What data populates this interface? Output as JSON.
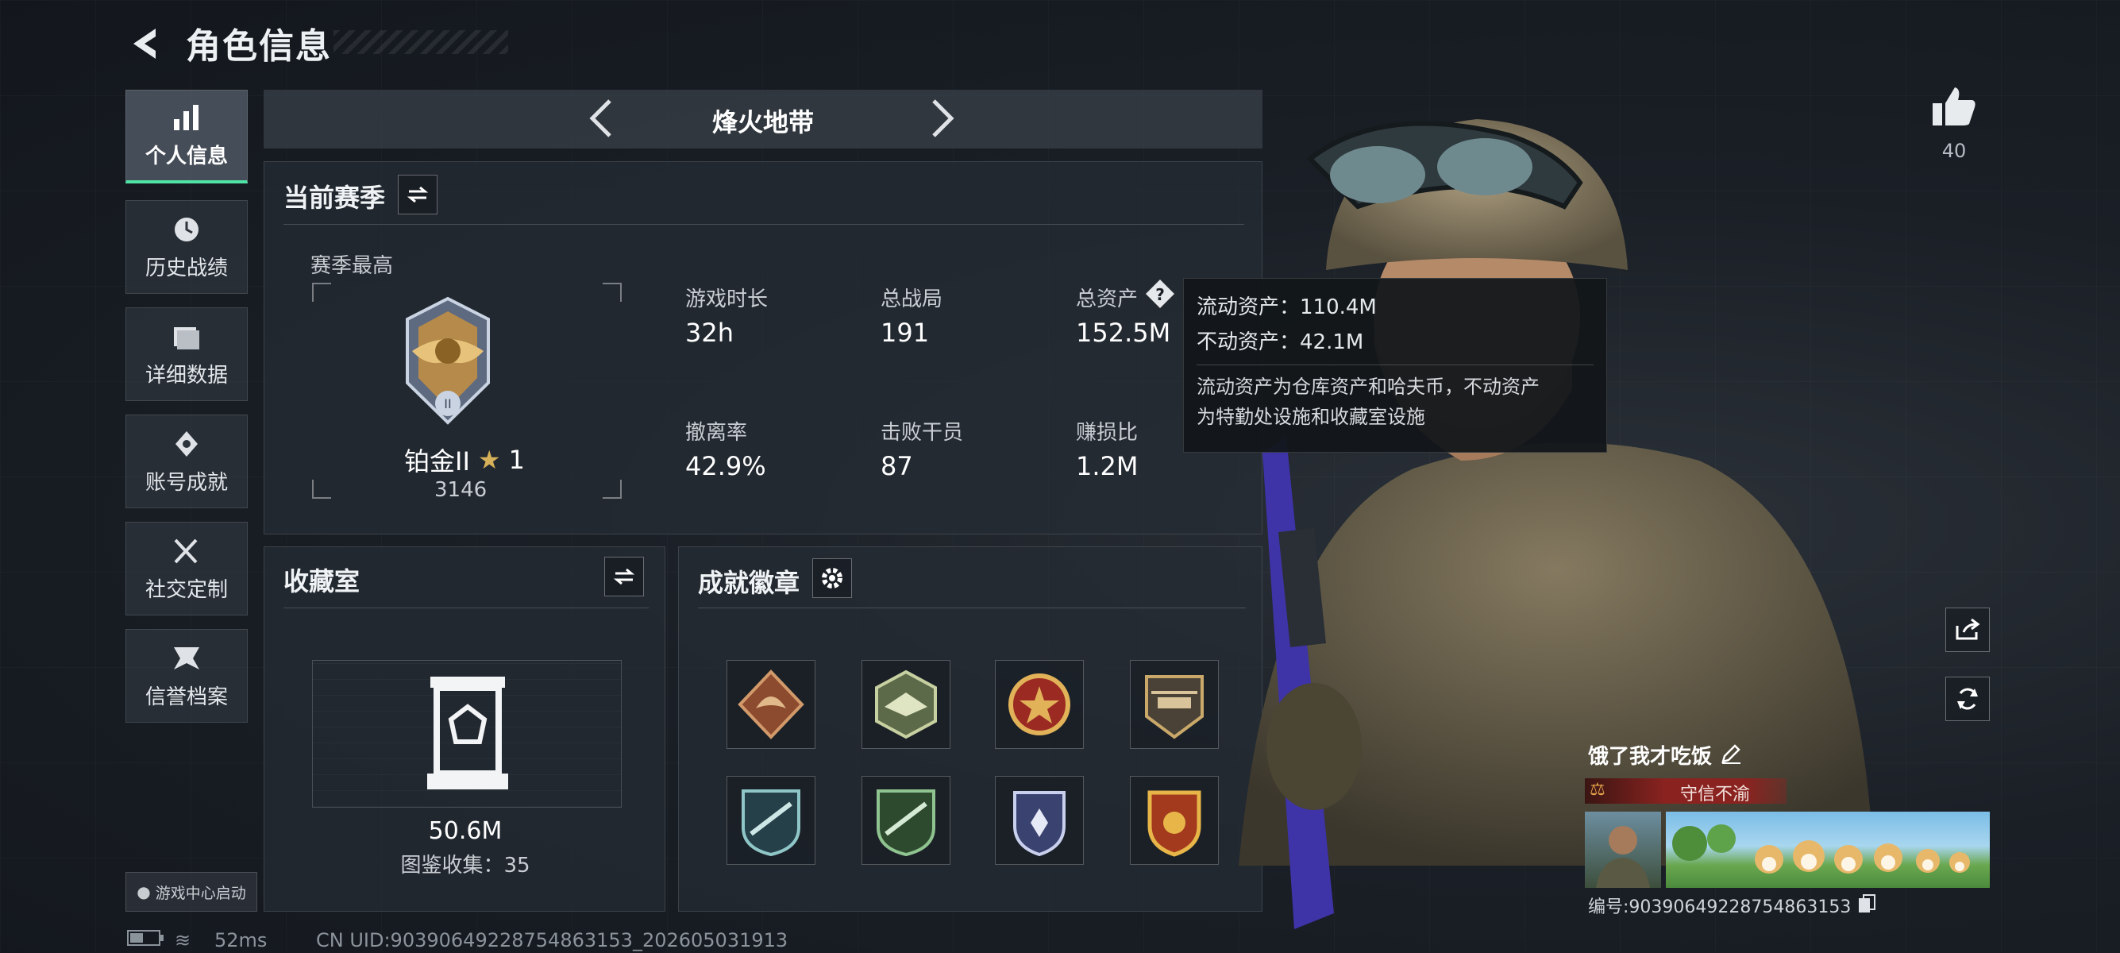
{
  "header": {
    "title": "角色信息"
  },
  "sidebar": {
    "items": [
      {
        "label": "个人信息",
        "icon": "bar-chart-icon",
        "active": true
      },
      {
        "label": "历史战绩",
        "icon": "history-clock-icon"
      },
      {
        "label": "详细数据",
        "icon": "folder-icon"
      },
      {
        "label": "账号成就",
        "icon": "achievement-icon"
      },
      {
        "label": "社交定制",
        "icon": "tools-icon"
      },
      {
        "label": "信誉档案",
        "icon": "credit-icon"
      }
    ],
    "launch_label": "游戏中心启动"
  },
  "status_bar": {
    "ping": "52ms",
    "uid": "CN UID:90390649228754863153_202605031913"
  },
  "mode": {
    "name": "烽火地带"
  },
  "season": {
    "title": "当前赛季",
    "best_label": "赛季最高",
    "rank_name": "铂金II",
    "rank_stars": "1",
    "rank_score": "3146",
    "stats": [
      {
        "label": "游戏时长",
        "value": "32h"
      },
      {
        "label": "总战局",
        "value": "191"
      },
      {
        "label": "总资产",
        "value": "152.5M"
      },
      {
        "label": "撤离率",
        "value": "42.9%"
      },
      {
        "label": "击败干员",
        "value": "87"
      },
      {
        "label": "赚损比",
        "value": "1.2M"
      }
    ]
  },
  "tooltip": {
    "line1": "流动资产：110.4M",
    "line2": "不动资产：42.1M",
    "desc1": "流动资产为仓库资产和哈夫币，不动资产",
    "desc2": "为特勤处设施和收藏室设施"
  },
  "collection": {
    "title": "收藏室",
    "value": "50.6M",
    "caption": "图鉴收集：35"
  },
  "achievements": {
    "title": "成就徽章",
    "badges": [
      "dragon-badge-icon",
      "bird-badge-icon",
      "star-medal-icon",
      "helicopter-badge-icon",
      "rifle-badge-icon",
      "rifle-green-badge-icon",
      "shield-star-badge-icon",
      "gold-shield-badge-icon"
    ]
  },
  "likes": {
    "count": "40"
  },
  "player": {
    "name": "饿了我才吃饭",
    "reputation": "守信不渝",
    "id_label": "编号:90390649228754863153"
  },
  "colors": {
    "accent": "#4fe3a6",
    "reputation_bg": "#8a2320"
  }
}
